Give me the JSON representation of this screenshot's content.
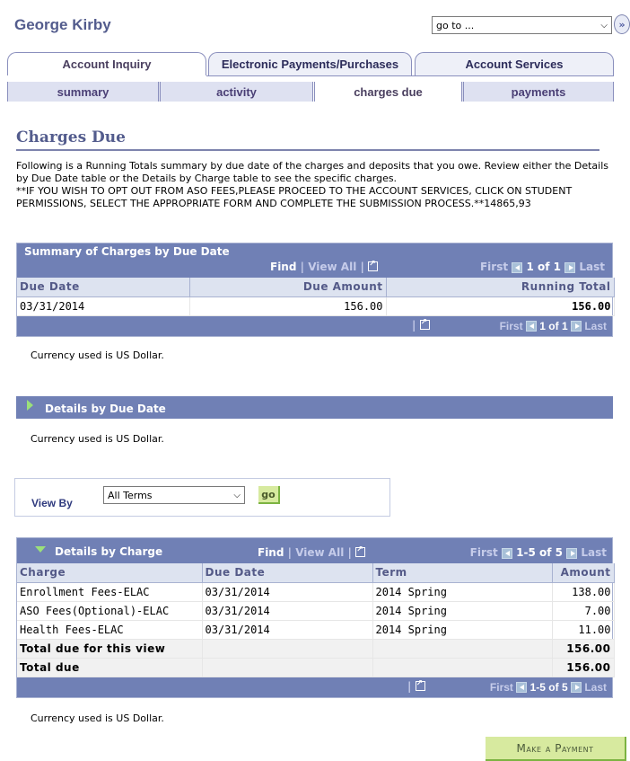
{
  "header": {
    "user_name": "George Kirby",
    "goto_select": {
      "value": "go to ...",
      "chevron": "▾"
    },
    "goto_button_icon": "»"
  },
  "tabs": [
    {
      "label": "Account Inquiry",
      "active": true
    },
    {
      "label": "Electronic Payments/Purchases",
      "active": false
    },
    {
      "label": "Account Services",
      "active": false
    }
  ],
  "subtabs": [
    {
      "label": "summary",
      "active": false
    },
    {
      "label": "activity",
      "active": false
    },
    {
      "label": "charges due",
      "active": true
    },
    {
      "label": "payments",
      "active": false
    }
  ],
  "page": {
    "title": "Charges Due",
    "intro": "Following is a Running Totals summary by due date of the charges and deposits that you owe.  Review either the Details by Due Date table or the Details by Charge table to see the specific charges.",
    "notice": "**IF YOU WISH TO OPT OUT FROM ASO FEES,PLEASE PROCEED TO THE ACCOUNT SERVICES, CLICK ON STUDENT PERMISSIONS, SELECT THE APPROPRIATE FORM AND COMPLETE THE SUBMISSION PROCESS.**14865,93"
  },
  "summary_grid": {
    "title": "Summary of Charges by Due Date",
    "find": "Find",
    "sep": "|",
    "view_all": "View All",
    "first": "First",
    "last": "Last",
    "range": "1 of 1",
    "columns": [
      "Due Date",
      "Due Amount",
      "Running Total"
    ],
    "rows": [
      {
        "due_date": "03/31/2014",
        "due_amount": "156.00",
        "running_total": "156.00"
      }
    ],
    "currency_note": "Currency used is US Dollar."
  },
  "due_date_section": {
    "title": "Details by Due Date",
    "currency_note": "Currency used is US Dollar."
  },
  "view_by": {
    "label": "View By",
    "selected": "All Terms",
    "chevron": "▾",
    "go_label": "go"
  },
  "charge_grid": {
    "title": "Details by Charge",
    "find": "Find",
    "sep": "|",
    "view_all": "View All",
    "first": "First",
    "last": "Last",
    "range": "1-5 of 5",
    "columns": [
      "Charge",
      "Due Date",
      "Term",
      "Amount"
    ],
    "rows": [
      {
        "charge": "Enrollment Fees-ELAC",
        "due_date": "03/31/2014",
        "term": "2014 Spring",
        "amount": "138.00"
      },
      {
        "charge": "ASO Fees(Optional)-ELAC",
        "due_date": "03/31/2014",
        "term": "2014 Spring",
        "amount": "7.00"
      },
      {
        "charge": "Health Fees-ELAC",
        "due_date": "03/31/2014",
        "term": "2014 Spring",
        "amount": "11.00"
      }
    ],
    "totals": [
      {
        "label": "Total due for this view",
        "amount": "156.00"
      },
      {
        "label": "Total due",
        "amount": "156.00"
      }
    ],
    "currency_note": "Currency used is US Dollar."
  },
  "make_payment_label": "Make a Payment",
  "colors": {
    "header_bar": "#7080b5",
    "column_header_bg": "#dde3f0",
    "title_color": "#535c8d",
    "button_green": "#d7ea9f"
  }
}
